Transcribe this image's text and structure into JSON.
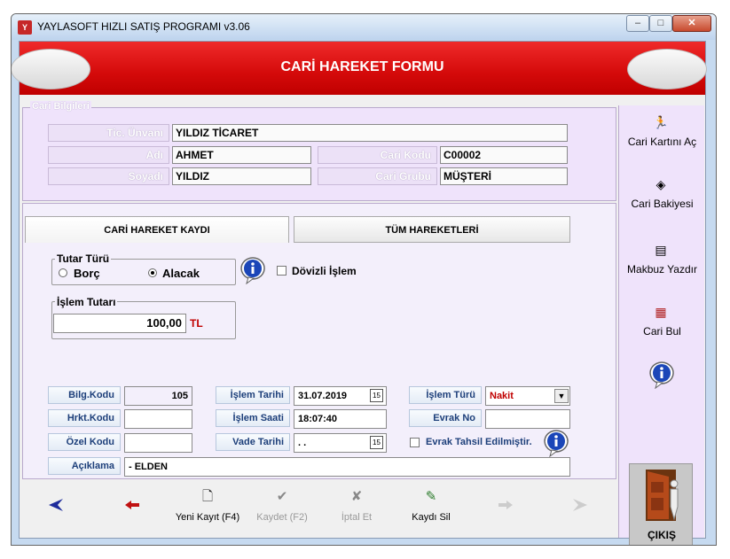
{
  "window": {
    "title": "YAYLASOFT HIZLI SATIŞ PROGRAMI v3.06",
    "minimize": "–",
    "maximize": "□",
    "close": "✕"
  },
  "form_title": "CARİ HAREKET FORMU",
  "cari": {
    "legend": "Cari Bilgileri",
    "unvan_label": "Tic. Ünvanı",
    "unvan": "YILDIZ TİCARET",
    "adi_label": "Adı",
    "adi": "AHMET",
    "soyadi_label": "Soyadı",
    "soyadi": "YILDIZ",
    "kodu_label": "Cari Kodu",
    "kodu": "C00002",
    "grubu_label": "Cari Grubu",
    "grubu": "MÜŞTERİ"
  },
  "tabs": [
    "CARİ HAREKET KAYDI",
    "TÜM HAREKETLERİ"
  ],
  "tutar_turu": {
    "title": "Tutar Türü",
    "borc": "Borç",
    "alacak": "Alacak",
    "selected": "Alacak"
  },
  "dovizli": {
    "label": "Dövizli İşlem",
    "checked": false
  },
  "islem_tutari": {
    "title": "İşlem Tutarı",
    "value": "100,00",
    "currency": "TL"
  },
  "fields": {
    "bilg_kodu_label": "Bilg.Kodu",
    "bilg_kodu": "105",
    "hrkt_kodu_label": "Hrkt.Kodu",
    "hrkt_kodu": "",
    "ozel_kodu_label": "Özel Kodu",
    "ozel_kodu": "",
    "islem_tarihi_label": "İşlem Tarihi",
    "islem_tarihi": "31.07.2019",
    "islem_saati_label": "İşlem Saati",
    "islem_saati": "18:07:40",
    "vade_tarihi_label": "Vade Tarihi",
    "vade_tarihi": " .  .",
    "islem_turu_label": "İşlem Türü",
    "islem_turu": "Nakit",
    "evrak_no_label": "Evrak No",
    "evrak_no": "",
    "evrak_tahsil_label": "Evrak Tahsil Edilmiştir.",
    "aciklama_label": "Açıklama",
    "aciklama": "-  ELDEN",
    "calendar_glyph": "15"
  },
  "bottom": {
    "yeni": "Yeni Kayıt (F4)",
    "kaydet": "Kaydet (F2)",
    "iptal": "İptal Et",
    "sil": "Kaydı Sil"
  },
  "sidebar": {
    "cari_karti": "Cari Kartını Aç",
    "cari_bakiye": "Cari Bakiyesi",
    "makbuz": "Makbuz Yazdır",
    "cari_bul": "Cari Bul",
    "cikis": "ÇIKIŞ"
  },
  "colors": {
    "banner": "#d40a0a",
    "label_blue": "#1d3f7a",
    "nakit_red": "#c00000"
  }
}
